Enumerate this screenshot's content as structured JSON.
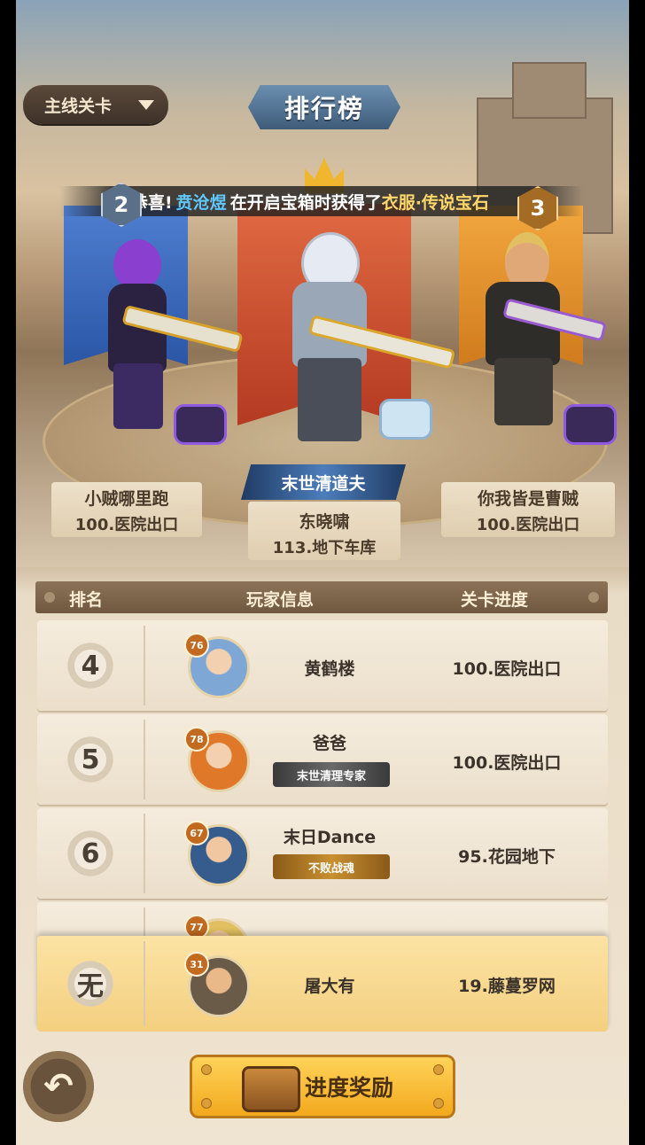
{
  "header": {
    "mode_label": "主线关卡",
    "title": "排行榜"
  },
  "marquee": {
    "prefix": "恭喜!",
    "player": "贲沧煜",
    "middle": "在开启宝箱时获得了",
    "item": "衣服·传说宝石"
  },
  "podium": [
    {
      "rank": "2",
      "name": "小贼哪里跑",
      "stage": "100.医院出口",
      "color": "#2b56a6"
    },
    {
      "rank": "1",
      "name": "东晓啸",
      "stage": "113.地下车库",
      "title": "末世清道夫",
      "color": "#b43a22"
    },
    {
      "rank": "3",
      "name": "你我皆是曹贼",
      "stage": "100.医院出口",
      "color": "#d07b1e"
    }
  ],
  "table": {
    "col_rank": "排名",
    "col_player": "玩家信息",
    "col_stage": "关卡进度",
    "rows": [
      {
        "rank": "4",
        "level": "76",
        "name": "黄鹤楼",
        "stage": "100.医院出口",
        "badge": ""
      },
      {
        "rank": "5",
        "level": "78",
        "name": "爸爸",
        "stage": "100.医院出口",
        "badge": "末世清理专家"
      },
      {
        "rank": "6",
        "level": "67",
        "name": "末日Dance",
        "stage": "95.花园地下",
        "badge": "不败战魂"
      },
      {
        "rank": "",
        "level": "77",
        "name": "",
        "stage": "",
        "badge": ""
      }
    ]
  },
  "me": {
    "rank": "无",
    "level": "31",
    "name": "屠大有",
    "stage": "19.藤蔓罗网"
  },
  "footer": {
    "reward_label": "进度奖励",
    "back_icon": "back-arrow-icon"
  }
}
